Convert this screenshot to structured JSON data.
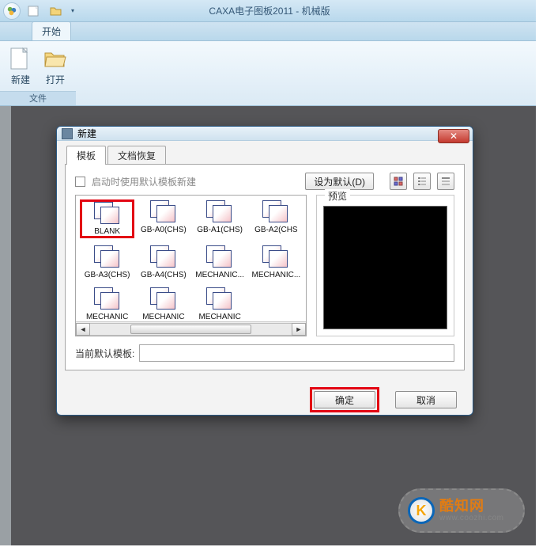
{
  "app": {
    "title": "CAXA电子图板2011 - 机械版"
  },
  "ribbon": {
    "tab_start": "开始",
    "group_file": "文件",
    "btn_new": "新建",
    "btn_open": "打开"
  },
  "dialog": {
    "title": "新建",
    "tab_template": "模板",
    "tab_recover": "文档恢复",
    "checkbox_label": "启动时使用默认模板新建",
    "set_default_btn": "设为默认(D)",
    "preview_label": "预览",
    "current_label": "当前默认模板:",
    "current_value": "",
    "ok": "确定",
    "cancel": "取消",
    "templates": [
      {
        "name": "BLANK",
        "selected": true
      },
      {
        "name": "GB-A0(CHS)"
      },
      {
        "name": "GB-A1(CHS)"
      },
      {
        "name": "GB-A2(CHS"
      },
      {
        "name": "GB-A3(CHS)"
      },
      {
        "name": "GB-A4(CHS)"
      },
      {
        "name": "MECHANIC..."
      },
      {
        "name": "MECHANIC..."
      },
      {
        "name": "MECHANIC"
      },
      {
        "name": "MECHANIC"
      },
      {
        "name": "MECHANIC"
      }
    ]
  },
  "watermark": {
    "cn": "酷知网",
    "en": "www.coozhi.com",
    "logo_letter": "K"
  }
}
